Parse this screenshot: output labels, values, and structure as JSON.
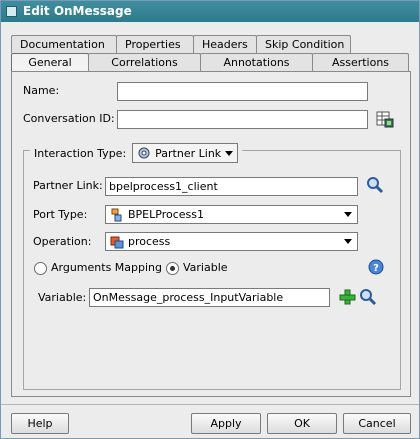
{
  "window": {
    "title": "Edit OnMessage"
  },
  "tabs_back": [
    "Documentation",
    "Properties",
    "Headers",
    "Skip Condition"
  ],
  "tabs_front": [
    "General",
    "Correlations",
    "Annotations",
    "Assertions"
  ],
  "active_tab": "General",
  "general": {
    "name_label": "Name:",
    "name_value": "",
    "conversation_label": "Conversation ID:",
    "conversation_value": "",
    "interaction_label": "Interaction Type:",
    "interaction_value": "Partner Link",
    "partner_link_label": "Partner Link:",
    "partner_link_value": "bpelprocess1_client",
    "port_type_label": "Port Type:",
    "port_type_value": "BPELProcess1",
    "operation_label": "Operation:",
    "operation_value": "process",
    "radio_arguments": "Arguments Mapping",
    "radio_variable": "Variable",
    "selected_radio": "Variable",
    "variable_label": "Variable:",
    "variable_value": "OnMessage_process_InputVariable"
  },
  "buttons": {
    "help": "Help",
    "apply": "Apply",
    "ok": "OK",
    "cancel": "Cancel"
  },
  "icons": {
    "conversation_generate": "table-generate-icon",
    "partner_link_search": "magnifier-icon",
    "variable_add": "green-plus-icon",
    "variable_search": "magnifier-icon",
    "help": "help-circle-icon"
  }
}
